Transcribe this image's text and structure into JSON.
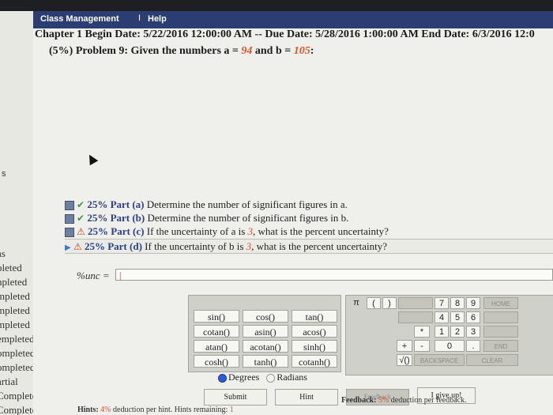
{
  "menu": {
    "class_management": "Class Management",
    "separator": "I",
    "help": "Help"
  },
  "header": {
    "line": "Chapter 1 Begin Date: 5/22/2016 12:00:00 AM -- Due Date: 5/28/2016 1:00:00 AM End Date: 6/3/2016 12:0"
  },
  "problem": {
    "prefix": "(5%) Problem 9: Given the numbers a = ",
    "a": "94",
    "mid": " and b = ",
    "b": "105",
    "suffix": ":"
  },
  "sidebar": {
    "top_char": "s",
    "items": [
      "as",
      "pleted",
      "npleted",
      "mpleted",
      "mpleted",
      "mpleted",
      "empleted",
      "ompleted",
      "ompleted",
      "artial",
      "Completed",
      "Completed"
    ]
  },
  "parts": [
    {
      "pct": "25% Part (a)",
      "text": "Determine the number of significant figures in a.",
      "status": "correct"
    },
    {
      "pct": "25% Part (b)",
      "text": "Determine the number of significant figures in b.",
      "status": "correct"
    },
    {
      "pct": "25% Part (c)",
      "text_before": "If the uncertainty of a is ",
      "value": "3",
      "text_after": ", what is the percent uncertainty?",
      "status": "warning"
    },
    {
      "pct": "25% Part (d)",
      "text_before": "If the uncertainty of b is ",
      "value": "3",
      "text_after": ", what is the percent uncertainty?",
      "status": "warning-active"
    }
  ],
  "answer": {
    "label": "%unc =",
    "value": "|"
  },
  "functions": [
    "sin()",
    "cos()",
    "tan()",
    "cotan()",
    "asin()",
    "acos()",
    "atan()",
    "acotan()",
    "sinh()",
    "cosh()",
    "tanh()",
    "cotanh()"
  ],
  "angle_modes": {
    "degrees": "Degrees",
    "radians": "Radians",
    "selected": "Degrees"
  },
  "keypad": {
    "pi": "π",
    "lparen": "(",
    "rparen": ")",
    "digits_row1": [
      "7",
      "8",
      "9"
    ],
    "digits_row2": [
      "4",
      "5",
      "6"
    ],
    "digits_row3": [
      "1",
      "2",
      "3"
    ],
    "zero": "0",
    "dot": ".",
    "plus": "+",
    "minus": "-",
    "times": "*",
    "sqrt": "√()",
    "home": "HOME",
    "end": "END",
    "backspace": "BACKSPACE",
    "clear": "CLEAR"
  },
  "buttons": {
    "submit": "Submit",
    "hint": "Hint",
    "feedback": "Feedback",
    "give_up": "I give up!"
  },
  "hints": {
    "label": "Hints:",
    "pct": "4%",
    "text": "deduction per hint. Hints remaining:",
    "remaining": "1"
  },
  "feedback": {
    "label": "Feedback:",
    "pct": "5%",
    "text": "deduction per feedback."
  },
  "colors": {
    "menubar": "#2b3e73",
    "accent_var": "#e0532a",
    "part_label": "#2b3e8a",
    "check": "#3d9a3a",
    "warn": "#d23a2a"
  }
}
